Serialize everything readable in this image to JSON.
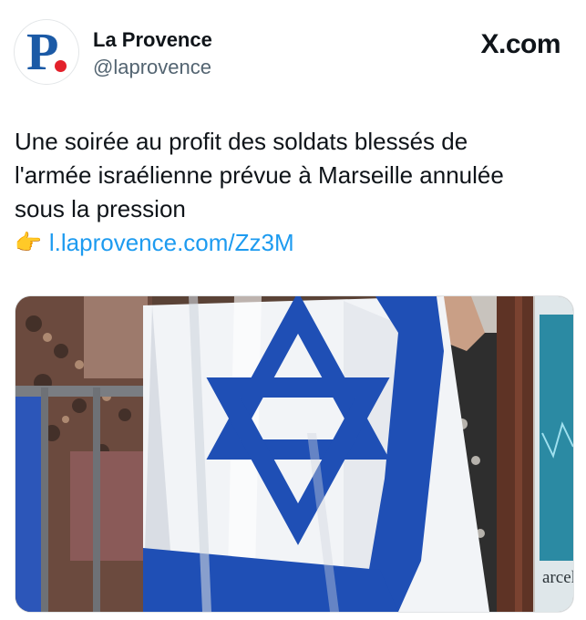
{
  "account": {
    "avatar_letter": "P",
    "name": "La Provence",
    "handle": "@laprovence"
  },
  "brand": "X.com",
  "tweet": {
    "text_lines": [
      "Une soirée au profit des soldats blessés de",
      "l'armée israélienne prévue à Marseille annulée",
      "sous la pression"
    ],
    "link_emoji": "👉",
    "link": "l.laprovence.com/Zz3M"
  },
  "media": {
    "description_icon": "israel-flag-photo",
    "partial_sign_text": "arcel"
  },
  "colors": {
    "accent_link": "#1d9bf0",
    "logo_blue": "#1b5aa6",
    "logo_red": "#e3212b",
    "flag_blue": "#1f4fb5"
  }
}
